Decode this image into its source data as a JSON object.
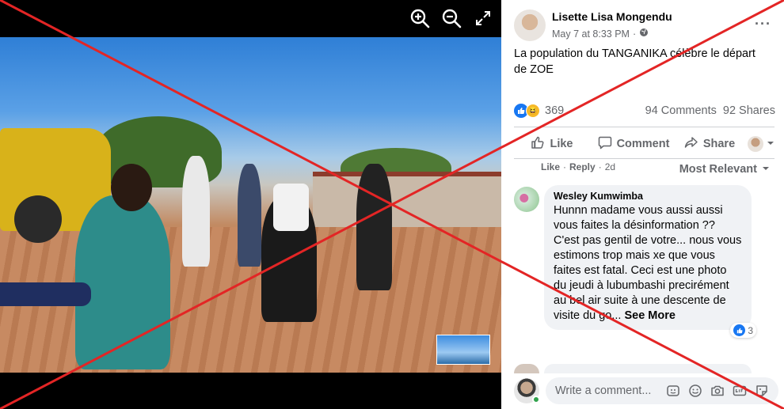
{
  "viewer": {
    "zoom_in": "zoom-in",
    "zoom_out": "zoom-out",
    "fullscreen": "fullscreen"
  },
  "post": {
    "author": "Lisette Lisa Mongendu",
    "date": "May 7 at 8:33 PM",
    "separator": "·",
    "caption": "La population du TANGANIKA célèbre le départ de ZOE",
    "reaction_count": "369",
    "comments_count": "94 Comments",
    "shares_count": "92 Shares"
  },
  "actions": {
    "like": "Like",
    "comment": "Comment",
    "share": "Share"
  },
  "sort_label": "Most Relevant",
  "comment": {
    "author": "Wesley Kumwimba",
    "text": "Hunnn madame vous aussi aussi vous faites la désinformation ?? C'est pas gentil de votre... nous vous estimons trop mais xe que vous faites est fatal. Ceci est une photo du jeudi à lubumbashi precirément au bel air suite à une descente de visite du go...",
    "see_more": "See More",
    "reactions": "3",
    "like_link": "Like",
    "reply_link": "Reply",
    "time": "2d",
    "dot": "·"
  },
  "composer": {
    "placeholder": "Write a comment..."
  },
  "colors": {
    "accent": "#1877f2",
    "overlay_x": "#e32525",
    "online": "#31a24c"
  }
}
